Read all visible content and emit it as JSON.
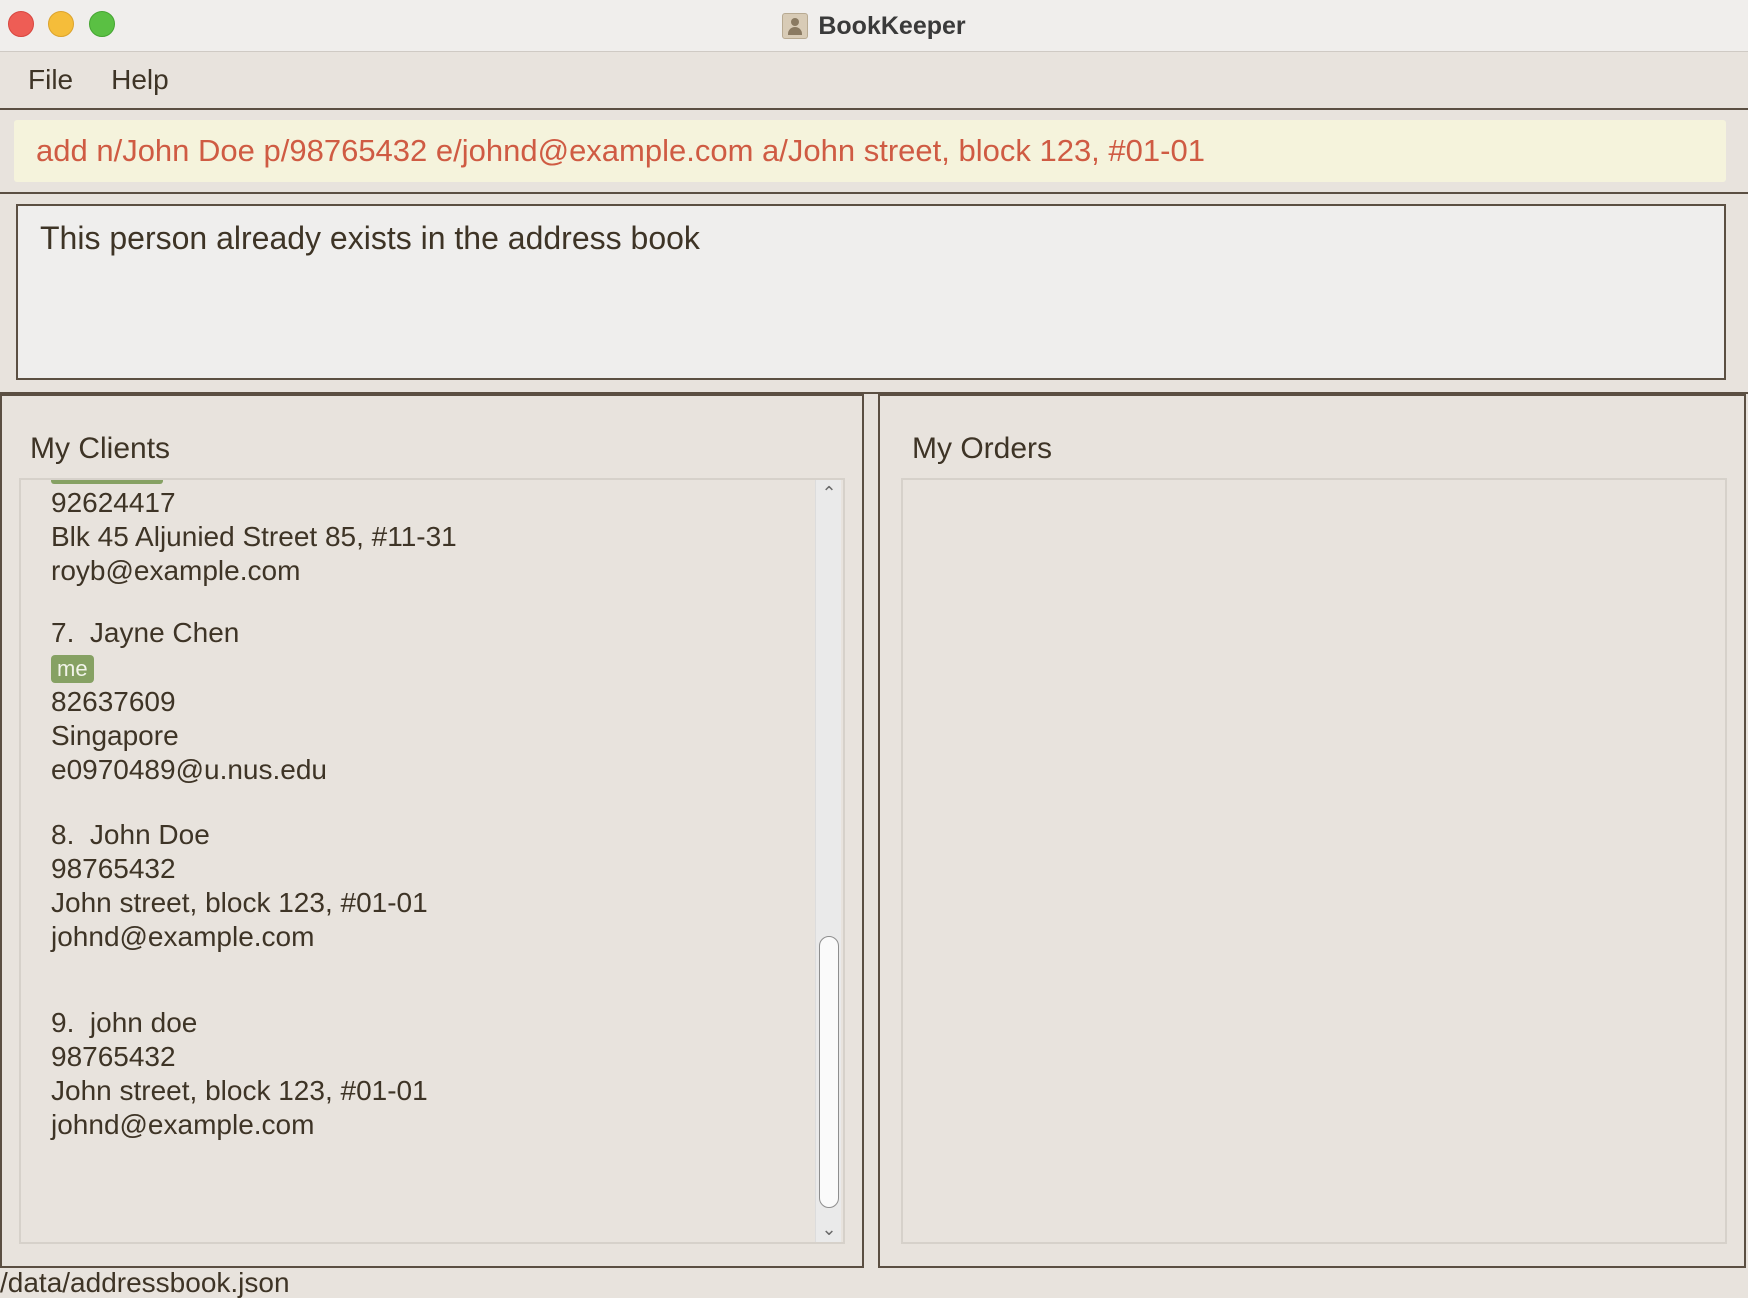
{
  "window": {
    "title": "BookKeeper",
    "app_icon": "contacts-book-icon"
  },
  "menu": {
    "items": [
      {
        "label": "File"
      },
      {
        "label": "Help"
      }
    ]
  },
  "command": {
    "value": "add n/John Doe p/98765432 e/johnd@example.com a/John street, block 123, #01-01"
  },
  "result": {
    "message": "This person already exists in the address book"
  },
  "clients": {
    "heading": "My Clients",
    "partial_card": {
      "phone": "92624417",
      "address": "Blk 45 Aljunied Street 85, #11-31",
      "email": "royb@example.com"
    },
    "cards": [
      {
        "index": "7.",
        "name": "Jayne Chen",
        "tags": [
          "me"
        ],
        "phone": "82637609",
        "address": "Singapore",
        "email": "e0970489@u.nus.edu"
      },
      {
        "index": "8.",
        "name": "John Doe",
        "tags": [],
        "phone": "98765432",
        "address": "John street, block 123, #01-01",
        "email": "johnd@example.com"
      },
      {
        "index": "9.",
        "name": "john doe",
        "tags": [],
        "phone": "98765432",
        "address": "John street, block 123, #01-01",
        "email": "johnd@example.com"
      }
    ]
  },
  "orders": {
    "heading": "My Orders"
  },
  "status": {
    "path": "/data/addressbook.json"
  },
  "colors": {
    "command_text": "#cf5b43",
    "command_bg": "#f5f3dc",
    "tag_bg": "#86a163",
    "panel_border": "#5b4f42",
    "window_bg": "#e8e3dd"
  }
}
